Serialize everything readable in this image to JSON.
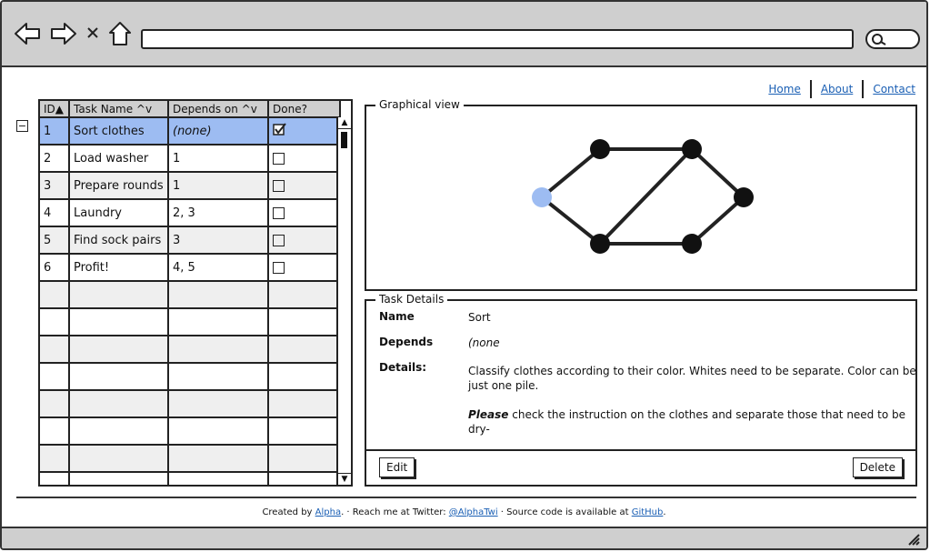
{
  "nav": {
    "home": "Home",
    "about": "About",
    "contact": "Contact"
  },
  "grid": {
    "headers": [
      "ID▲",
      "Task Name ^v",
      "Depends on ^v",
      "Done?"
    ],
    "rows": [
      {
        "id": "1",
        "name": "Sort clothes",
        "depends": "(none)",
        "done": true
      },
      {
        "id": "2",
        "name": "Load washer",
        "depends": "1",
        "done": false
      },
      {
        "id": "3",
        "name": "Prepare rounds",
        "depends": "1",
        "done": false
      },
      {
        "id": "4",
        "name": "Laundry",
        "depends": "2, 3",
        "done": false
      },
      {
        "id": "5",
        "name": "Find sock pairs",
        "depends": "3",
        "done": false
      },
      {
        "id": "6",
        "name": "Profit!",
        "depends": "4, 5",
        "done": false
      }
    ]
  },
  "graph": {
    "legend": "Graphical view"
  },
  "details": {
    "legend": "Task Details",
    "name_label": "Name",
    "name_value": "Sort",
    "depends_label": "Depends",
    "depends_value": "(none",
    "details_label": "Details:",
    "details_text1": "Classify clothes according to their color. Whites need to be separate. Color can be just one pile.",
    "details_text2_bold": "Please",
    "details_text2": " check the instruction on the clothes and separate those that need to be dry-",
    "edit": "Edit",
    "delete": "Delete"
  },
  "footer": {
    "t1": "Created by ",
    "author": "Alpha",
    "t2": ". · Reach me at Twitter: ",
    "twitter": "@AlphaTwi",
    "t3": " · Source code is available at ",
    "github": "GitHub",
    "t4": "."
  },
  "colors": {
    "selected_row": "#9dbcf2",
    "start_node": "#9dbcf2",
    "link": "#1a5fb4"
  }
}
